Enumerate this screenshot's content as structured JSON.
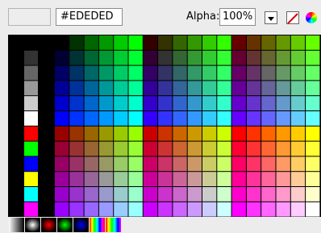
{
  "toolbar": {
    "hex_value": "#EDEDED",
    "alpha_label": "Alpha:",
    "alpha_value": "100%",
    "preview_color": "#ededed"
  },
  "left_column": {
    "gray_swatches": [
      "#000000",
      "#333333",
      "#666666",
      "#999999",
      "#cccccc",
      "#ffffff"
    ],
    "primary_swatches": [
      "#ff0000",
      "#00ff00",
      "#0000ff",
      "#ffff00",
      "#00ffff",
      "#ff00ff"
    ]
  },
  "swatch_palette": {
    "levels": [
      "00",
      "33",
      "66",
      "99",
      "cc",
      "ff"
    ],
    "blocks_per_row": 3,
    "block_rows": 2,
    "block_size": 6
  },
  "gradient_swatches": [
    {
      "name": "linear-gradient-swatch",
      "colors": [
        "#ffffff",
        "#000000"
      ]
    },
    {
      "name": "radial-gradient-swatch",
      "colors": [
        "#ffffff",
        "#000000"
      ]
    },
    {
      "name": "radial-red-swatch",
      "colors": [
        "#ff0000",
        "#000000"
      ]
    },
    {
      "name": "radial-green-swatch",
      "colors": [
        "#00ff00",
        "#000000"
      ]
    },
    {
      "name": "radial-blue-swatch",
      "colors": [
        "#0000ff",
        "#000000"
      ]
    },
    {
      "name": "linear-rainbow-swatch",
      "colors": [
        "#ff0000",
        "#ffff00",
        "#00ff00",
        "#00ffff",
        "#0000ff",
        "#ff00ff",
        "#ff0000"
      ]
    },
    {
      "name": "linear-spectrum-swatch",
      "colors": [
        "#ff0000",
        "#ffff00",
        "#00ff00",
        "#00ffff",
        "#0000ff",
        "#ff00ff"
      ]
    }
  ]
}
